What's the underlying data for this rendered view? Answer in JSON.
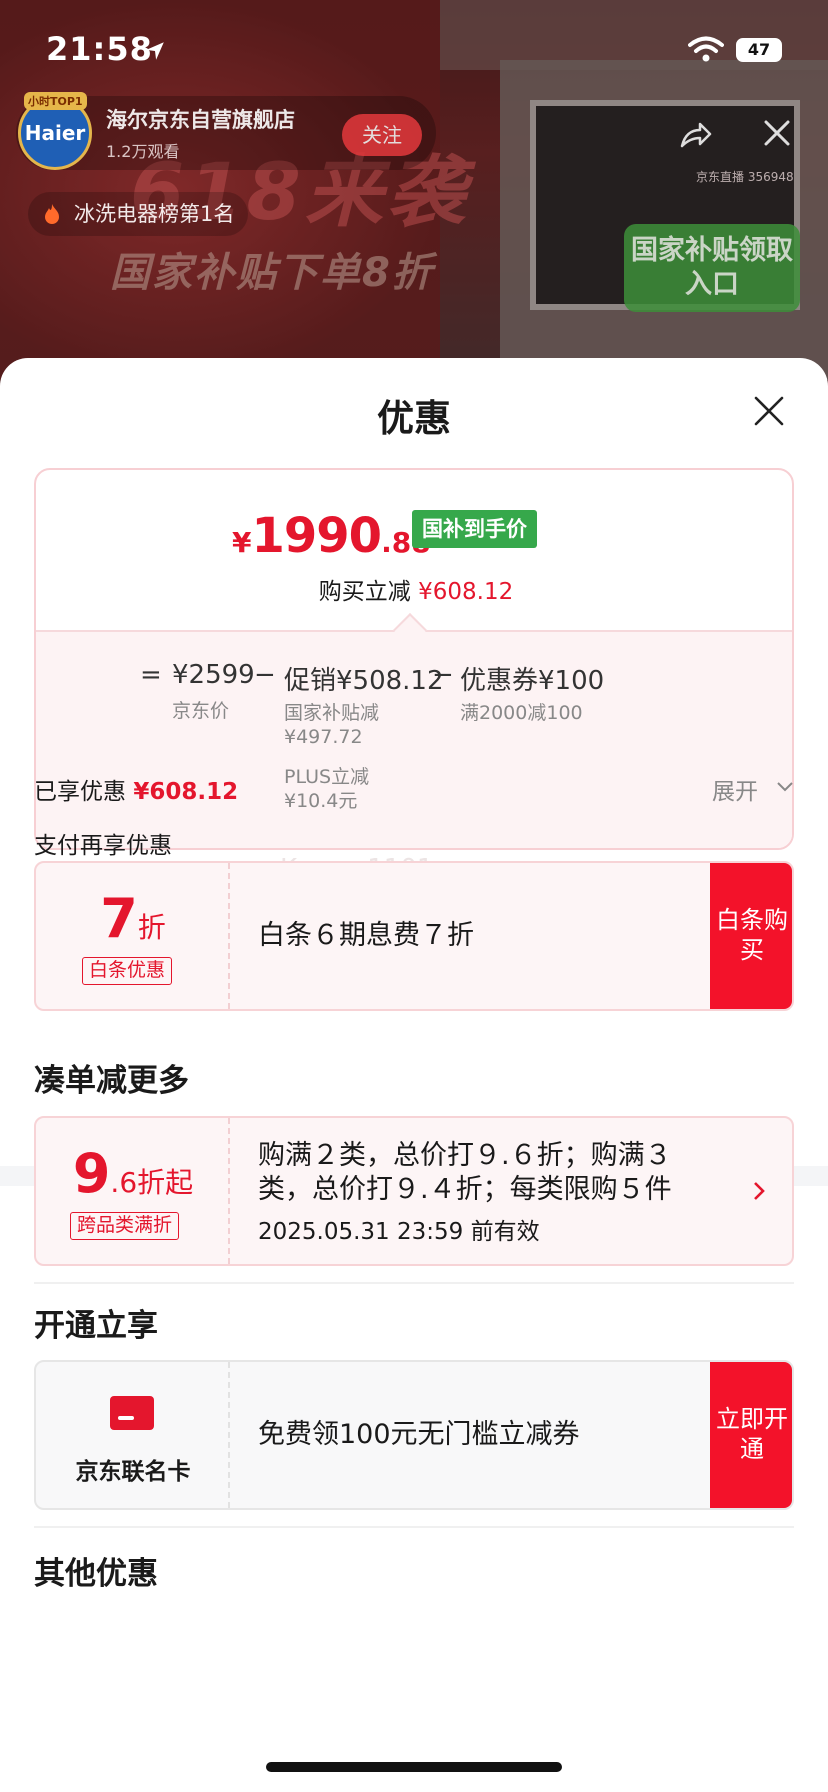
{
  "status_bar": {
    "time": "21:58",
    "battery": "47"
  },
  "live": {
    "shop_badge": "小时TOP1",
    "shop_logo": "Haier",
    "shop_name": "海尔京东自营旗舰店",
    "viewers": "1.2万观看",
    "follow": "关注",
    "rank": "冰洗电器榜第1名",
    "live_id": "京东直播 356948",
    "banner_title": "618来袭",
    "banner_sub": "国家补贴下单8折",
    "subsidy_entry": "国家补贴领取入口"
  },
  "sheet": {
    "title": "优惠",
    "price": {
      "symbol": "¥",
      "integer": "1990",
      "decimal": ".88",
      "tag": "国补到手价"
    },
    "save_label": "购买立减",
    "save_value": "¥608.12",
    "breakdown": {
      "equals": "=",
      "base": {
        "value": "¥2599",
        "label": "京东价"
      },
      "minus1": "−",
      "promo": {
        "value": "促销¥508.12",
        "sub1": "国家补贴减",
        "sub1_val": "¥497.72",
        "sub2": "PLUS立减",
        "sub2_val": "¥10.4元"
      },
      "minus2": "−",
      "coupon": {
        "value": "优惠券¥100",
        "label": "满2000减100"
      }
    },
    "watermark": "Koren_1101",
    "enjoyed_label": "已享优惠",
    "enjoyed_value": "¥608.12",
    "expand": "展开",
    "pay_section": "支付再享优惠",
    "baitiao": {
      "num": "7",
      "unit": "折",
      "tag": "白条优惠",
      "text": "白条６期息费７折",
      "action": "白条购买"
    },
    "bundle_title": "凑单减更多",
    "bundle": {
      "num": "9",
      "unit": ".6折起",
      "tag": "跨品类满折",
      "line1": "购满２类，总价打９.６折；购满３",
      "line2": "类，总价打９.４折；每类限购５件",
      "line3": "2025.05.31 23:59 前有效"
    },
    "member_title": "开通立享",
    "card": {
      "label": "京东联名卡",
      "text": "免费领100元无门槛立减券",
      "action": "立即开通"
    },
    "other_title": "其他优惠"
  }
}
